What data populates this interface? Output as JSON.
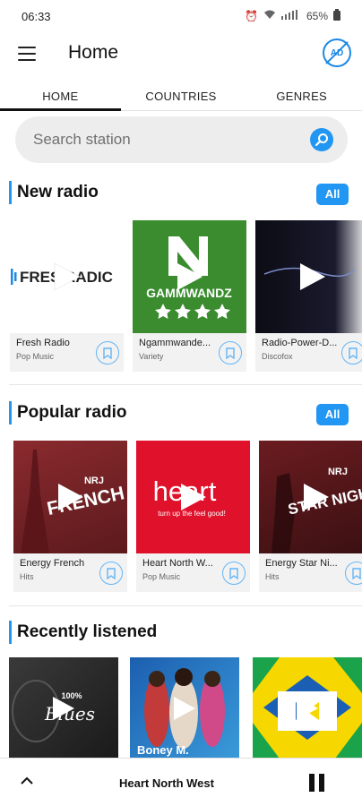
{
  "status": {
    "time": "06:33",
    "battery": "65%"
  },
  "header": {
    "title": "Home",
    "ad_label": "AD"
  },
  "tabs": [
    {
      "label": "HOME"
    },
    {
      "label": "COUNTRIES"
    },
    {
      "label": "GENRES"
    }
  ],
  "search": {
    "placeholder": "Search station"
  },
  "sections": {
    "new_radio": {
      "title": "New radio",
      "all_label": "All",
      "items": [
        {
          "name": "Fresh Radio",
          "genre": "Pop Music",
          "art_text": "FRES RADIC"
        },
        {
          "name": "Ngammwande...",
          "genre": "Variety",
          "art_text": "GAMMWANDZ"
        },
        {
          "name": "Radio-Power-D...",
          "genre": "Discofox",
          "art_text": ""
        }
      ]
    },
    "popular_radio": {
      "title": "Popular radio",
      "all_label": "All",
      "items": [
        {
          "name": "Energy French",
          "genre": "Hits",
          "art_text": "FRENCH",
          "art_brand": "NRJ"
        },
        {
          "name": "Heart North W...",
          "genre": "Pop Music",
          "art_text": "heart",
          "art_sub": "turn up the feel good!"
        },
        {
          "name": "Energy Star Ni...",
          "genre": "Hits",
          "art_text": "STAR NIGHT",
          "art_brand": "NRJ"
        }
      ]
    },
    "recently_listened": {
      "title": "Recently listened",
      "items": [
        {
          "art_text": "Blues",
          "art_sub": "100%"
        },
        {
          "art_text": "Boney M."
        },
        {
          "art_text": ""
        }
      ]
    }
  },
  "player": {
    "now_playing": "Heart North West"
  },
  "colors": {
    "accent": "#2196f3",
    "heart_red": "#e0112b",
    "nrj_red": "#9b1c22",
    "green": "#3a8c2f"
  }
}
